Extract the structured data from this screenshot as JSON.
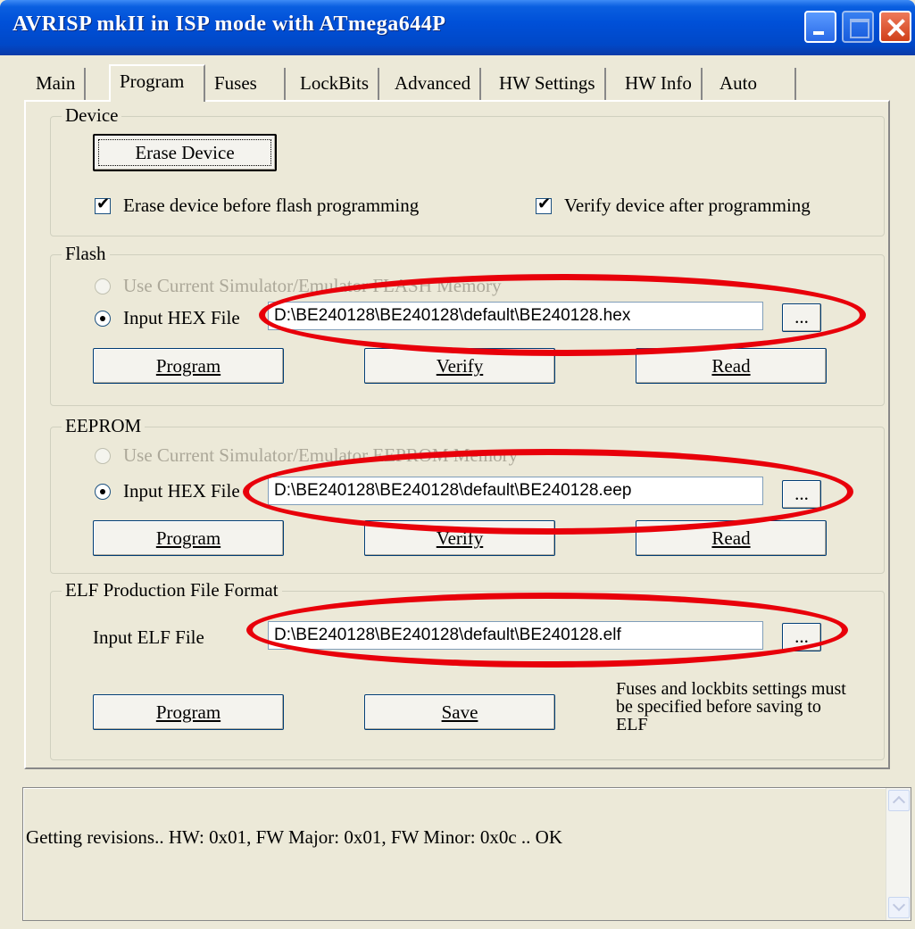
{
  "window": {
    "title": "AVRISP mkII in ISP mode with ATmega644P"
  },
  "tabs": [
    {
      "label": "Main"
    },
    {
      "label": "Program",
      "active": true
    },
    {
      "label": "Fuses"
    },
    {
      "label": "LockBits"
    },
    {
      "label": "Advanced"
    },
    {
      "label": "HW Settings"
    },
    {
      "label": "HW Info"
    },
    {
      "label": "Auto"
    }
  ],
  "device": {
    "group_title": "Device",
    "erase_button": "Erase Device",
    "erase_before_flash": {
      "label": "Erase device before flash programming",
      "checked": true
    },
    "verify_after_program": {
      "label": "Verify device after programming",
      "checked": true
    }
  },
  "flash": {
    "group_title": "Flash",
    "use_simulator_label": "Use Current Simulator/Emulator FLASH Memory",
    "input_hex_label": "Input HEX File",
    "file_path": "D:\\BE240128\\BE240128\\default\\BE240128.hex",
    "browse_label": "...",
    "program_label": "Program",
    "verify_label": "Verify",
    "read_label": "Read"
  },
  "eeprom": {
    "group_title": "EEPROM",
    "use_simulator_label": "Use Current Simulator/Emulator EEPROM Memory",
    "input_hex_label": "Input HEX File",
    "file_path": "D:\\BE240128\\BE240128\\default\\BE240128.eep",
    "browse_label": "...",
    "program_label": "Program",
    "verify_label": "Verify",
    "read_label": "Read"
  },
  "elf": {
    "group_title": "ELF Production File Format",
    "input_elf_label": "Input ELF File",
    "file_path": "D:\\BE240128\\BE240128\\default\\BE240128.elf",
    "browse_label": "...",
    "program_label": "Program",
    "save_label": "Save",
    "note_line1": "Fuses and lockbits settings must",
    "note_line2": "be specified before saving to",
    "note_line3": "ELF"
  },
  "status": {
    "message": "Getting revisions.. HW: 0x01, FW Major: 0x01, FW Minor: 0x0c .. OK"
  },
  "colors": {
    "highlight_ellipse": "#e8000a",
    "titlebar": "#0050d8",
    "dialog_bg": "#ece9d8"
  }
}
